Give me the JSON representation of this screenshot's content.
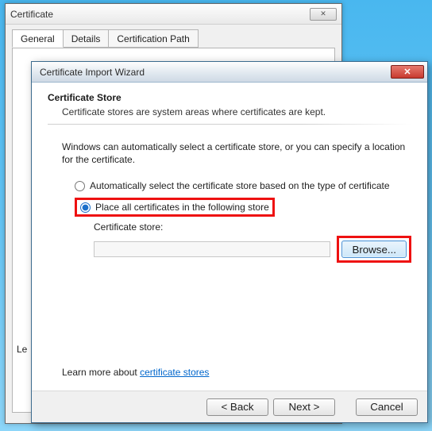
{
  "back_window": {
    "title": "Certificate",
    "tabs": [
      "General",
      "Details",
      "Certification Path"
    ],
    "active_tab_index": 0,
    "truncated_text": "Le"
  },
  "wizard": {
    "title": "Certificate Import Wizard",
    "step_title": "Certificate Store",
    "step_sub": "Certificate stores are system areas where certificates are kept.",
    "description": "Windows can automatically select a certificate store, or you can specify a location for the certificate.",
    "radio": {
      "auto_label": "Automatically select the certificate store based on the type of certificate",
      "place_label": "Place all certificates in the following store",
      "selected": "place"
    },
    "store_label": "Certificate store:",
    "store_value": "",
    "browse_label": "Browse...",
    "learn_prefix": "Learn more about ",
    "learn_link": "certificate stores",
    "buttons": {
      "back": "< Back",
      "next": "Next >",
      "cancel": "Cancel"
    }
  }
}
